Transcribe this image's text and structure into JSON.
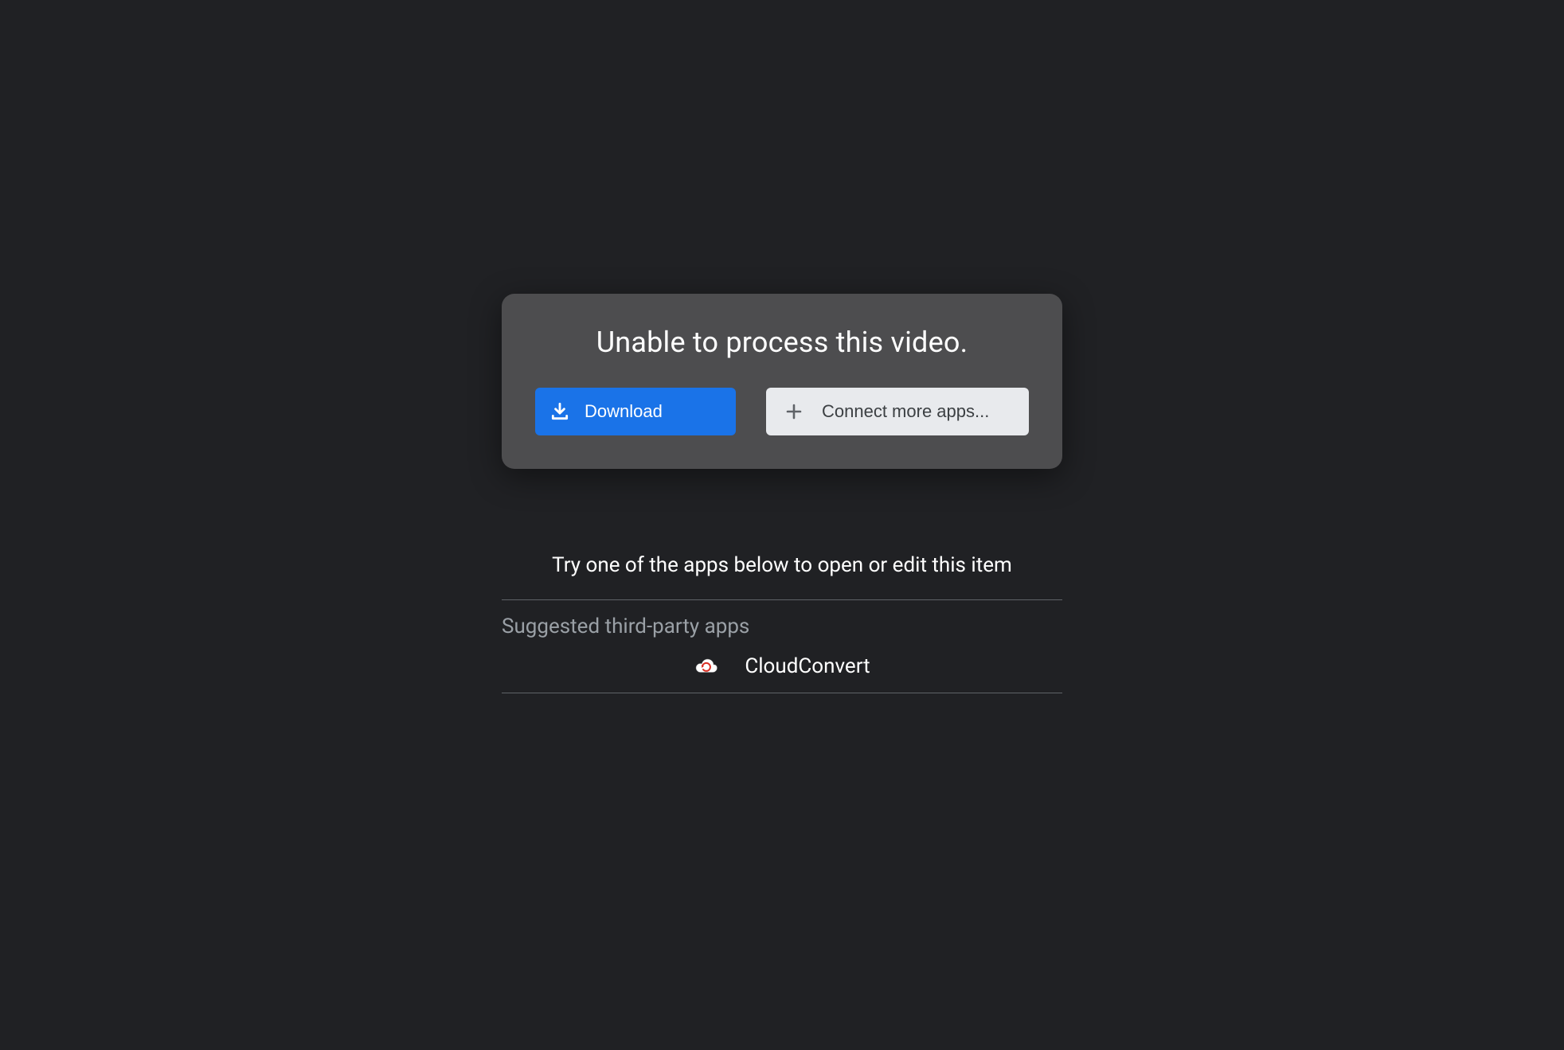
{
  "error": {
    "title": "Unable to process this video.",
    "download_label": "Download",
    "connect_label": "Connect more apps..."
  },
  "suggestions": {
    "try_text": "Try one of the apps below to open or edit this item",
    "heading": "Suggested third-party apps",
    "apps": [
      {
        "name": "CloudConvert",
        "icon": "cloud-convert-icon"
      }
    ]
  }
}
